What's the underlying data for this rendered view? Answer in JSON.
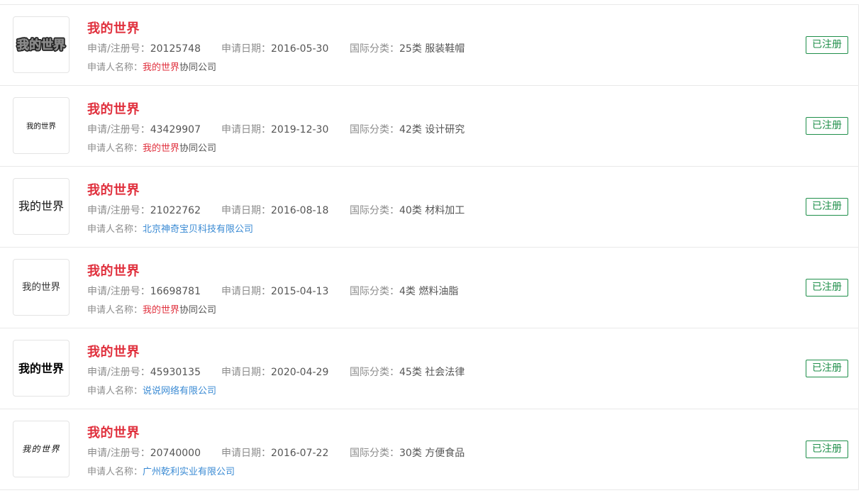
{
  "labels": {
    "reg_no": "申请/注册号：",
    "date": "申请日期：",
    "intl_class": "国际分类：",
    "applicant": "申请人名称："
  },
  "colors": {
    "title": "#e0303d",
    "status": "#1f8f4a",
    "applicant_link": "#3b8bd4"
  },
  "items": [
    {
      "logo_text": "我的世界",
      "logo_style": "bold-outlined-icon",
      "title": "我的世界",
      "reg_no": "20125748",
      "date": "2016-05-30",
      "class": "25类 服装鞋帽",
      "applicant_highlight": "我的世界",
      "applicant_rest": "协同公司",
      "applicant_full": "",
      "status": "已注册"
    },
    {
      "logo_text": "我的世界",
      "logo_style": "small-text",
      "title": "我的世界",
      "reg_no": "43429907",
      "date": "2019-12-30",
      "class": "42类 设计研究",
      "applicant_highlight": "我的世界",
      "applicant_rest": "协同公司",
      "applicant_full": "",
      "status": "已注册"
    },
    {
      "logo_text": "我的世界",
      "logo_style": "serif-text",
      "title": "我的世界",
      "reg_no": "21022762",
      "date": "2016-08-18",
      "class": "40类 材料加工",
      "applicant_highlight": "",
      "applicant_rest": "",
      "applicant_full": "北京神奇宝贝科技有限公司",
      "status": "已注册"
    },
    {
      "logo_text": "我的世界",
      "logo_style": "light-serif-text",
      "title": "我的世界",
      "reg_no": "16698781",
      "date": "2015-04-13",
      "class": "4类 燃料油脂",
      "applicant_highlight": "我的世界",
      "applicant_rest": "协同公司",
      "applicant_full": "",
      "status": "已注册"
    },
    {
      "logo_text": "我的世界",
      "logo_style": "bold-serif-text",
      "title": "我的世界",
      "reg_no": "45930135",
      "date": "2020-04-29",
      "class": "45类 社会法律",
      "applicant_highlight": "",
      "applicant_rest": "",
      "applicant_full": "说说网络有限公司",
      "status": "已注册"
    },
    {
      "logo_text": "我的世界",
      "logo_style": "brush-text",
      "title": "我的世界",
      "reg_no": "20740000",
      "date": "2016-07-22",
      "class": "30类 方便食品",
      "applicant_highlight": "",
      "applicant_rest": "",
      "applicant_full": "广州乾利实业有限公司",
      "status": "已注册"
    }
  ]
}
